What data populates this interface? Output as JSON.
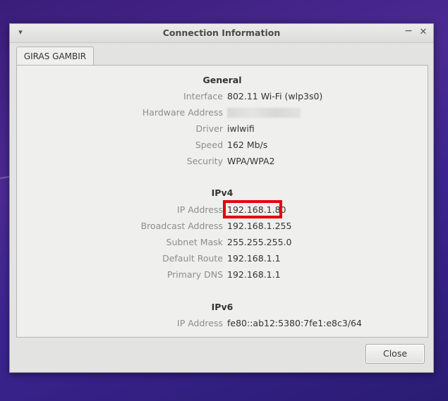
{
  "window": {
    "title": "Connection Information",
    "menu_icon": "chevron-down-icon",
    "minimize_icon": "minimize-icon",
    "close_icon": "close-icon"
  },
  "tab": {
    "label": "GIRAS GAMBIR"
  },
  "general": {
    "header": "General",
    "rows": [
      {
        "label": "Interface",
        "value": "802.11 Wi-Fi (wlp3s0)"
      },
      {
        "label": "Hardware Address",
        "value": ""
      },
      {
        "label": "Driver",
        "value": "iwlwifi"
      },
      {
        "label": "Speed",
        "value": "162 Mb/s"
      },
      {
        "label": "Security",
        "value": "WPA/WPA2"
      }
    ]
  },
  "ipv4": {
    "header": "IPv4",
    "rows": [
      {
        "label": "IP Address",
        "value": "192.168.1.80"
      },
      {
        "label": "Broadcast Address",
        "value": "192.168.1.255"
      },
      {
        "label": "Subnet Mask",
        "value": "255.255.255.0"
      },
      {
        "label": "Default Route",
        "value": "192.168.1.1"
      },
      {
        "label": "Primary DNS",
        "value": "192.168.1.1"
      }
    ]
  },
  "ipv6": {
    "header": "IPv6",
    "rows": [
      {
        "label": "IP Address",
        "value": "fe80::ab12:5380:7fe1:e8c3/64"
      }
    ]
  },
  "buttons": {
    "close_label": "Close"
  },
  "colors": {
    "highlight": "#e8000a",
    "desktop": "#3b2490"
  }
}
